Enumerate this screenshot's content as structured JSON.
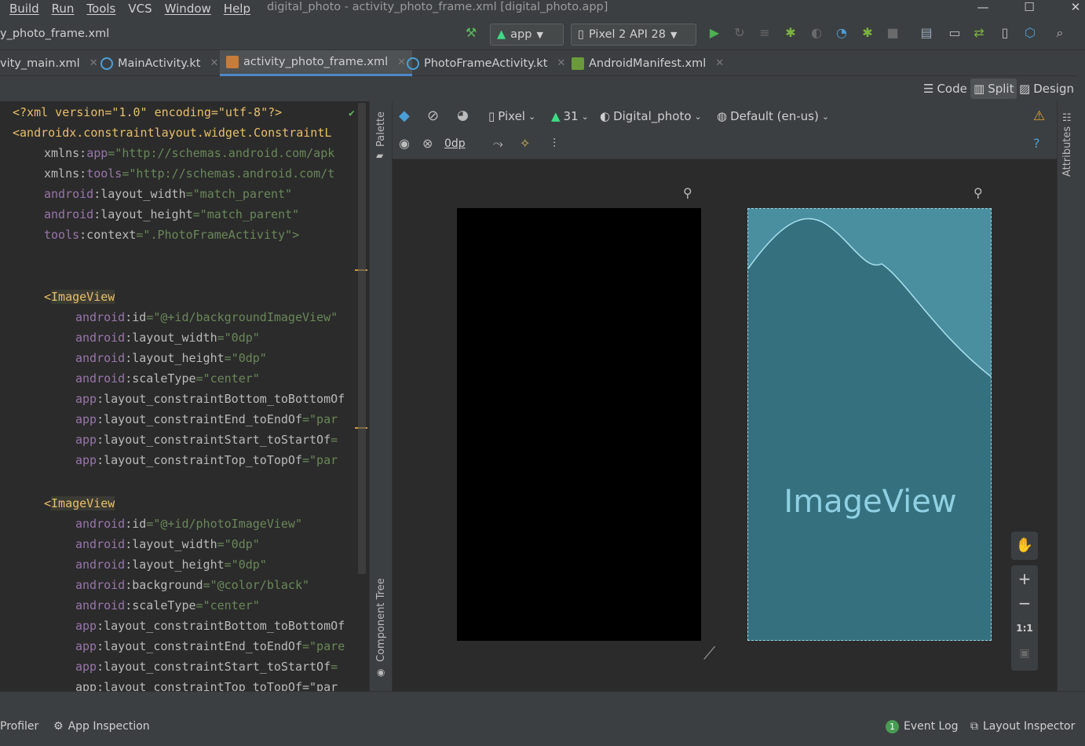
{
  "menu": [
    "Build",
    "Run",
    "Tools",
    "VCS",
    "Window",
    "Help"
  ],
  "window_title": "digital_photo - activity_photo_frame.xml [digital_photo.app]",
  "breadcrumb": "y_photo_frame.xml",
  "toolbar": {
    "run_config": "app",
    "device": "Pixel 2 API 28"
  },
  "tabs": [
    {
      "label": "vity_main.xml",
      "active": false
    },
    {
      "label": "MainActivity.kt",
      "active": false
    },
    {
      "label": "activity_photo_frame.xml",
      "active": true
    },
    {
      "label": "PhotoFrameActivity.kt",
      "active": false
    },
    {
      "label": "AndroidManifest.xml",
      "active": false
    }
  ],
  "modes": {
    "code": "Code",
    "split": "Split",
    "design": "Design"
  },
  "side_panels": {
    "palette": "Palette",
    "component_tree": "Component Tree",
    "attributes": "Attributes"
  },
  "design_toolbar": {
    "device": "Pixel",
    "api": "31",
    "theme": "Digital_photo",
    "locale": "Default (en-us)",
    "margin": "0dp"
  },
  "preview": {
    "label": "ImageView"
  },
  "zoom": {
    "one_to_one": "1:1"
  },
  "code": {
    "xml_decl": "<?xml version=\"1.0\" encoding=\"utf-8\"?>",
    "root_tag": "<androidx.constraintlayout.widget.ConstraintL",
    "xmlns_app_ns": "xmlns:",
    "xmlns_app_attr": "app",
    "xmlns_app_val": "=\"http://schemas.android.com/apk",
    "xmlns_tools_attr": "tools",
    "xmlns_tools_val": "=\"http://schemas.android.com/t",
    "root_width": "=\"match_parent\"",
    "root_height": "=\"match_parent\"",
    "root_context": "=\".PhotoFrameActivity\">",
    "iv1_id": "=\"@+id/backgroundImageView\"",
    "iv2_id": "=\"@+id/photoImageView\"",
    "zero_dp": "=\"0dp\"",
    "center": "=\"center\"",
    "black": "=\"@color/black\"",
    "bottom_bottom_of": ":layout_constraintBottom_toBottomOf",
    "end_end_of": ":layout_constraintEnd_toEndOf",
    "start_start_of": ":layout_constraintStart_toStartOf",
    "top_top_of": ":layout_constraintTop_toTopOf",
    "par_val": "=\"par",
    "par_val_cut": "=\"pare",
    "eq": "=",
    "last_line": "app:layout_constraintTop_toTopOf=\"par"
  },
  "bottom": {
    "profiler": "Profiler",
    "app_inspection": "App Inspection",
    "event_log": "Event Log",
    "event_count": "1",
    "layout_inspector": "Layout Inspector"
  },
  "colors": {
    "accent": "#4a88c7",
    "preview_fill": "#35707f",
    "android_green": "#3ddc84"
  }
}
